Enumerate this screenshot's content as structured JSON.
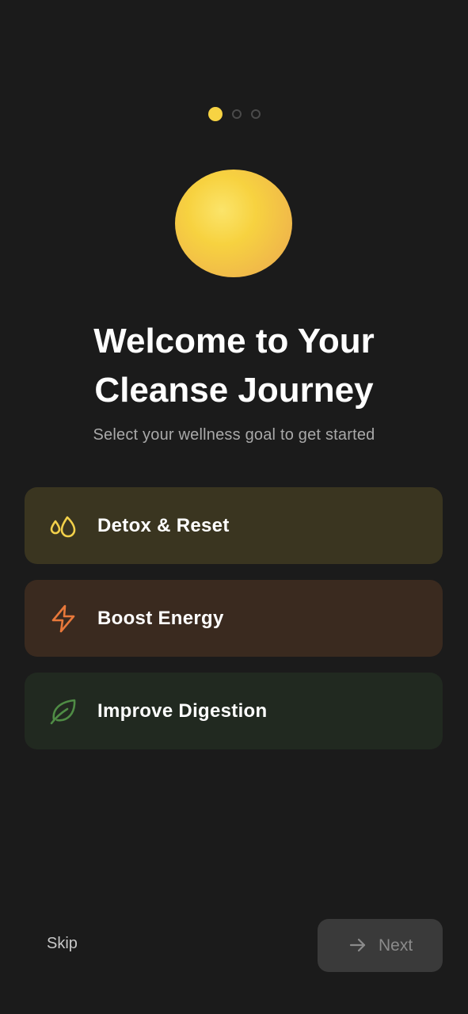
{
  "pager": {
    "total_steps": 3,
    "current_step": 1
  },
  "hero": {
    "title_line1": "Welcome to Your",
    "title_line2": "Cleanse Journey",
    "subtitle": "Select your wellness goal to get started"
  },
  "goals": [
    {
      "label": "Detox & Reset",
      "icon": "water-drops-icon",
      "accent": "#f2d04a"
    },
    {
      "label": "Boost Energy",
      "icon": "lightning-bolt-icon",
      "accent": "#e8783a"
    },
    {
      "label": "Improve Digestion",
      "icon": "leaf-icon",
      "accent": "#4f8c45"
    }
  ],
  "footer": {
    "skip_label": "Skip",
    "next_label": "Next",
    "next_icon": "arrow-right-icon"
  },
  "colors": {
    "background": "#1b1b1b",
    "accent_yellow": "#f7d343"
  }
}
